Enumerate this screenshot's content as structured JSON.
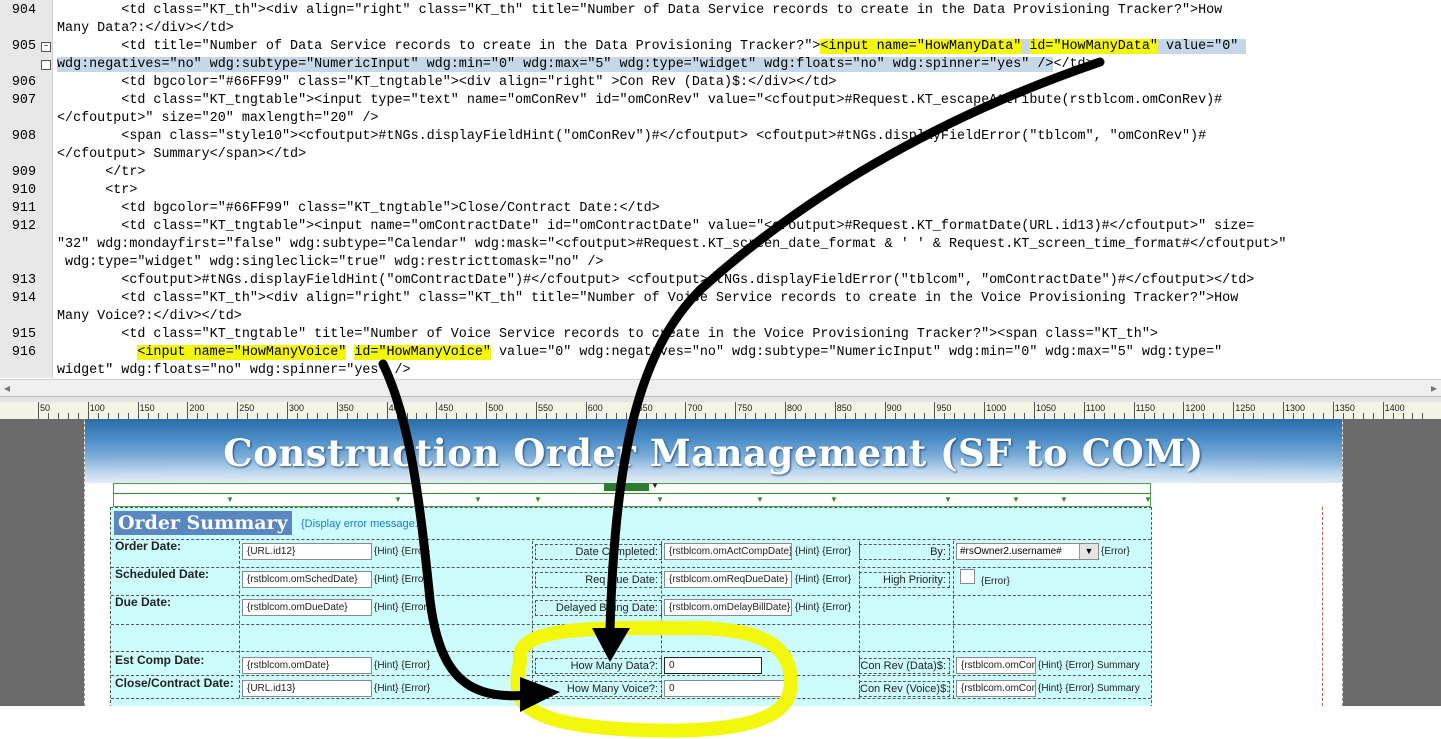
{
  "editor": {
    "lines": [
      {
        "num": "904",
        "parts": [
          [
            "t",
            "        <td class=\"KT_th\"><div align=\"right\" class=\"KT_th\" title=\"Number of Data Service records to create in the Data Provisioning Tracker?\">How"
          ]
        ]
      },
      {
        "num": "",
        "parts": [
          [
            "t",
            "Many Data?:</div></td>"
          ]
        ]
      },
      {
        "num": "905",
        "parts": [
          [
            "t",
            "        <td title=\"Number of Data Service records to create in the Data Provisioning Tracker?\">"
          ],
          [
            "hl",
            "<input name=\"HowManyData\""
          ],
          [
            "sel",
            " "
          ],
          [
            "hl",
            "id=\"HowManyData\""
          ],
          [
            "sel",
            " value=\"0\" "
          ]
        ]
      },
      {
        "num": "",
        "parts": [
          [
            "sel",
            "wdg:negatives=\"no\" wdg:subtype=\"NumericInput\" wdg:min=\"0\" wdg:max=\"5\" wdg:type=\"widget\" wdg:floats=\"no\" wdg:spinner=\"yes\" />"
          ],
          [
            "t",
            "</td>"
          ]
        ]
      },
      {
        "num": "906",
        "parts": [
          [
            "t",
            "        <td bgcolor=\"#66FF99\" class=\"KT_tngtable\"><div align=\"right\" >Con Rev (Data)$:</div></td>"
          ]
        ]
      },
      {
        "num": "907",
        "parts": [
          [
            "t",
            "        <td class=\"KT_tngtable\"><input type=\"text\" name=\"omConRev\" id=\"omConRev\" value=\"<cfoutput>#Request.KT_escapeAttribute(rstblcom.omConRev)#"
          ]
        ]
      },
      {
        "num": "",
        "parts": [
          [
            "t",
            "</cfoutput>\" size=\"20\" maxlength=\"20\" />"
          ]
        ]
      },
      {
        "num": "908",
        "parts": [
          [
            "t",
            "        <span class=\"style10\"><cfoutput>#tNGs.displayFieldHint(\"omConRev\")#</cfoutput> <cfoutput>#tNGs.displayFieldError(\"tblcom\", \"omConRev\")#"
          ]
        ]
      },
      {
        "num": "",
        "parts": [
          [
            "t",
            "</cfoutput> Summary</span></td>"
          ]
        ]
      },
      {
        "num": "909",
        "parts": [
          [
            "t",
            "      </tr>"
          ]
        ]
      },
      {
        "num": "910",
        "parts": [
          [
            "t",
            "      <tr>"
          ]
        ]
      },
      {
        "num": "911",
        "parts": [
          [
            "t",
            "        <td bgcolor=\"#66FF99\" class=\"KT_tngtable\">Close/Contract Date:</td>"
          ]
        ]
      },
      {
        "num": "912",
        "parts": [
          [
            "t",
            "        <td class=\"KT_tngtable\"><input name=\"omContractDate\" id=\"omContractDate\" value=\"<cfoutput>#Request.KT_formatDate(URL.id13)#</cfoutput>\" size="
          ]
        ]
      },
      {
        "num": "",
        "parts": [
          [
            "t",
            "\"32\" wdg:mondayfirst=\"false\" wdg:subtype=\"Calendar\" wdg:mask=\"<cfoutput>#Request.KT_screen_date_format & ' ' & Request.KT_screen_time_format#</cfoutput>\""
          ]
        ]
      },
      {
        "num": "",
        "parts": [
          [
            "t",
            " wdg:type=\"widget\" wdg:singleclick=\"true\" wdg:restricttomask=\"no\" />"
          ]
        ]
      },
      {
        "num": "913",
        "parts": [
          [
            "t",
            "        <cfoutput>#tNGs.displayFieldHint(\"omContractDate\")#</cfoutput> <cfoutput>#tNGs.displayFieldError(\"tblcom\", \"omContractDate\")#</cfoutput></td>"
          ]
        ]
      },
      {
        "num": "914",
        "parts": [
          [
            "t",
            "        <td class=\"KT_th\"><div align=\"right\" class=\"KT_th\" title=\"Number of Voice Service records to create in the Voice Provisioning Tracker?\">How"
          ]
        ]
      },
      {
        "num": "",
        "parts": [
          [
            "t",
            "Many Voice?:</div></td>"
          ]
        ]
      },
      {
        "num": "915",
        "parts": [
          [
            "t",
            "        <td class=\"KT_tngtable\" title=\"Number of Voice Service records to create in the Voice Provisioning Tracker?\"><span class=\"KT_th\">"
          ]
        ]
      },
      {
        "num": "916",
        "parts": [
          [
            "t",
            "          "
          ],
          [
            "hl",
            "<input name=\"HowManyVoice\""
          ],
          [
            "t",
            " "
          ],
          [
            "hl",
            "id=\"HowManyVoice\""
          ],
          [
            "t",
            " value=\"0\" wdg:negatives=\"no\" wdg:subtype=\"NumericInput\" wdg:min=\"0\" wdg:max=\"5\" wdg:type=\""
          ]
        ]
      },
      {
        "num": "",
        "parts": [
          [
            "t",
            "widget\" wdg:floats=\"no\" wdg:spinner=\"yes\" />"
          ]
        ]
      }
    ]
  },
  "ruler": {
    "labels": [
      "50",
      "100",
      "150",
      "200",
      "250",
      "300",
      "350",
      "400",
      "450",
      "500",
      "550",
      "600",
      "650",
      "700",
      "750",
      "800",
      "850",
      "900",
      "950",
      "1000",
      "1050",
      "1100",
      "1150",
      "1200",
      "1250",
      "1300",
      "1350",
      "1400"
    ]
  },
  "design": {
    "banner_title": "Construction Order Management (SF to COM)",
    "summary_title": "Order Summary",
    "display_error": "{Display error message.}",
    "rows": [
      {
        "label": "Order Date:",
        "value": "{URL.id12}",
        "hint": "{Hint} {Error}",
        "mid_label": "Date Completed:",
        "mid_value": "{rstblcom.omActCompDate}",
        "mid_hint": "{Hint} {Error}",
        "right_label": "By:",
        "right_value": "#rsOwner2.username#",
        "right_hint": "{Error}"
      },
      {
        "label": "Scheduled Date:",
        "value": "{rstblcom.omSchedDate}",
        "hint": "{Hint} {Error}",
        "mid_label": "Req Due Date:",
        "mid_value": "{rstblcom.omReqDueDate}",
        "mid_hint": "{Hint} {Error}",
        "right_label": "High Priority:",
        "right_value": "",
        "right_hint": "{Error}"
      },
      {
        "label": "Due Date:",
        "value": "{rstblcom.omDueDate}",
        "hint": "{Hint} {Error}",
        "mid_label": "Delayed Billing Date:",
        "mid_value": "{rstblcom.omDelayBillDate}",
        "mid_hint": "{Hint} {Error}",
        "right_label": "",
        "right_value": "",
        "right_hint": ""
      },
      {
        "label": "Est Comp Date:",
        "value": "{rstblcom.omDate}",
        "hint": "{Hint} {Error}",
        "mid_label": "How Many Data?:",
        "mid_value": "0",
        "mid_hint": "",
        "right_label": "Con Rev (Data)$:",
        "right_value": "{rstblcom.omConRev}",
        "right_hint": "{Hint} {Error} Summary"
      },
      {
        "label": "Close/Contract Date:",
        "value": "{URL.id13}",
        "hint": "{Hint} {Error}",
        "mid_label": "How Many Voice?:",
        "mid_value": "0",
        "mid_hint": "",
        "right_label": "Con Rev (Voice)$:",
        "right_value": "{rstblcom.omConRev}",
        "right_hint": "{Hint} {Error} Summary"
      }
    ]
  },
  "colors": {
    "highlight": "#f3f70b",
    "selection": "#c6d7e8",
    "summary_bg": "#ccfcfc",
    "tag": "#0000e6"
  }
}
